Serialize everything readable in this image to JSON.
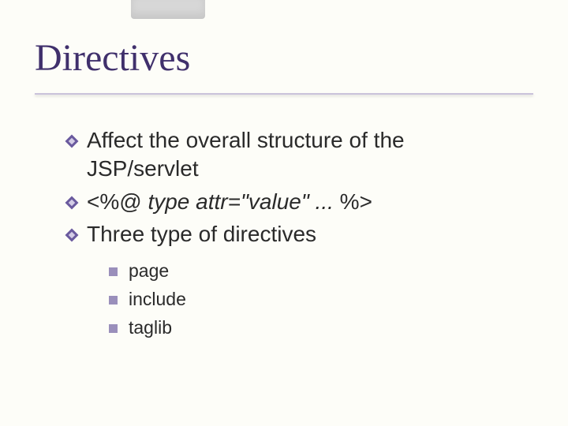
{
  "title": "Directives",
  "bullets": [
    {
      "text": "Affect the overall structure of the JSP/servlet"
    },
    {
      "prefix": "<%@ ",
      "italic": "type attr=\"value\" ...",
      "suffix": " %>"
    },
    {
      "text": "Three type of directives"
    }
  ],
  "subbullets": [
    {
      "text": "page"
    },
    {
      "text": "include"
    },
    {
      "text": "taglib"
    }
  ]
}
